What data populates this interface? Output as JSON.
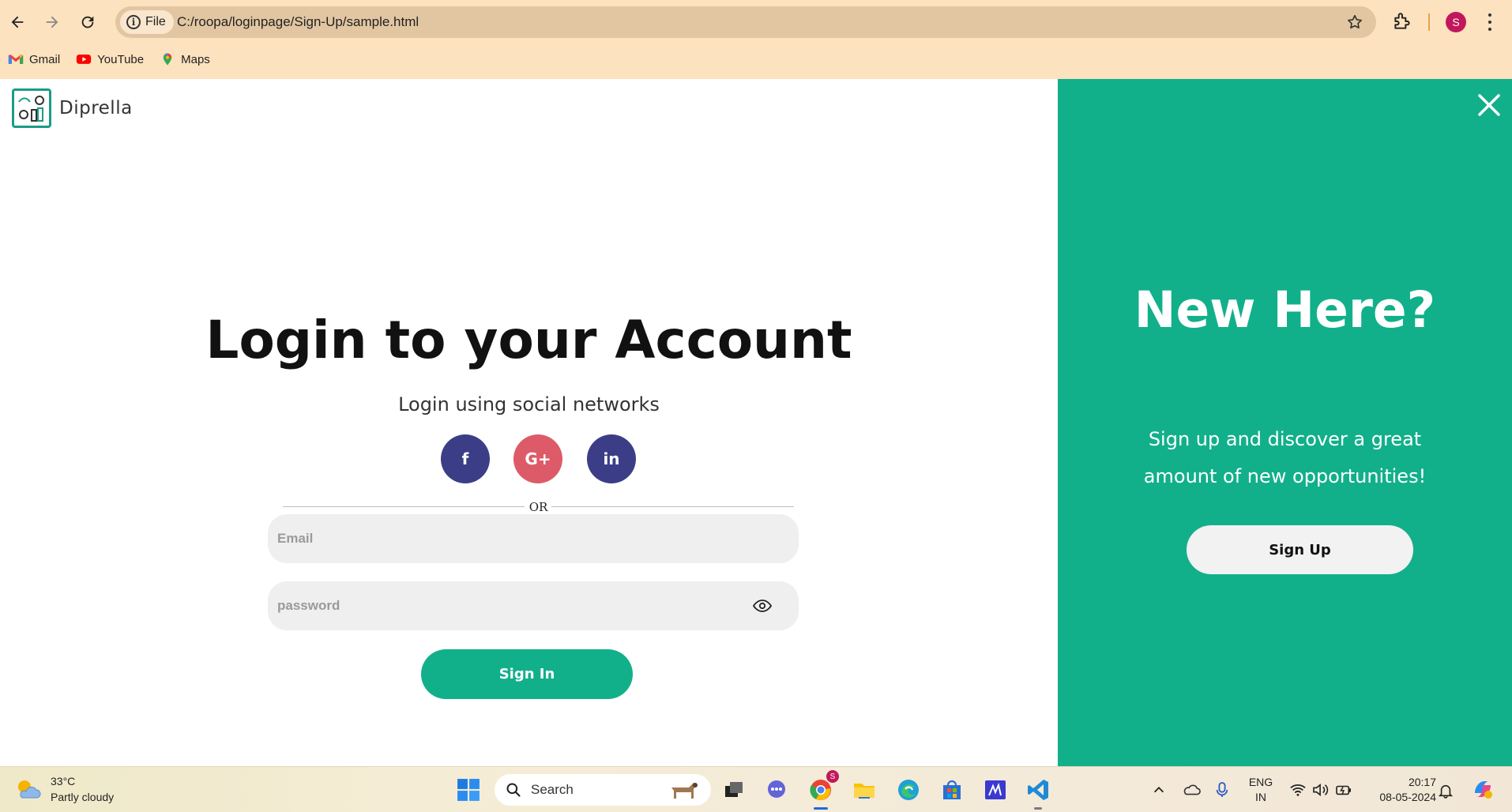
{
  "browser": {
    "file_chip_label": "File",
    "url": "C:/roopa/loginpage/Sign-Up/sample.html",
    "profile_initial": "S",
    "bookmarks": [
      {
        "label": "Gmail",
        "icon": "gmail-icon"
      },
      {
        "label": "YouTube",
        "icon": "youtube-icon"
      },
      {
        "label": "Maps",
        "icon": "maps-icon"
      }
    ]
  },
  "logo": {
    "text": "Diprella"
  },
  "login": {
    "title": "Login to your Account",
    "subtitle": "Login using social networks",
    "social": [
      {
        "label": "f",
        "network": "facebook",
        "color": "#3b3e87"
      },
      {
        "label": "G+",
        "network": "google-plus",
        "color": "#dd5b68"
      },
      {
        "label": "in",
        "network": "linkedin",
        "color": "#3b3e87"
      }
    ],
    "divider_text": "OR",
    "email_placeholder": "Email",
    "password_placeholder": "password",
    "signin_label": "Sign In"
  },
  "signup_panel": {
    "title": "New Here?",
    "subtitle": "Sign up and discover a great amount of new opportunities!",
    "button_label": "Sign Up",
    "accent_color": "#11b08a"
  },
  "taskbar": {
    "weather_temp": "33°C",
    "weather_desc": "Partly cloudy",
    "search_label": "Search",
    "language_line1": "ENG",
    "language_line2": "IN",
    "time": "20:17",
    "date": "08-05-2024",
    "chrome_badge": "S"
  }
}
